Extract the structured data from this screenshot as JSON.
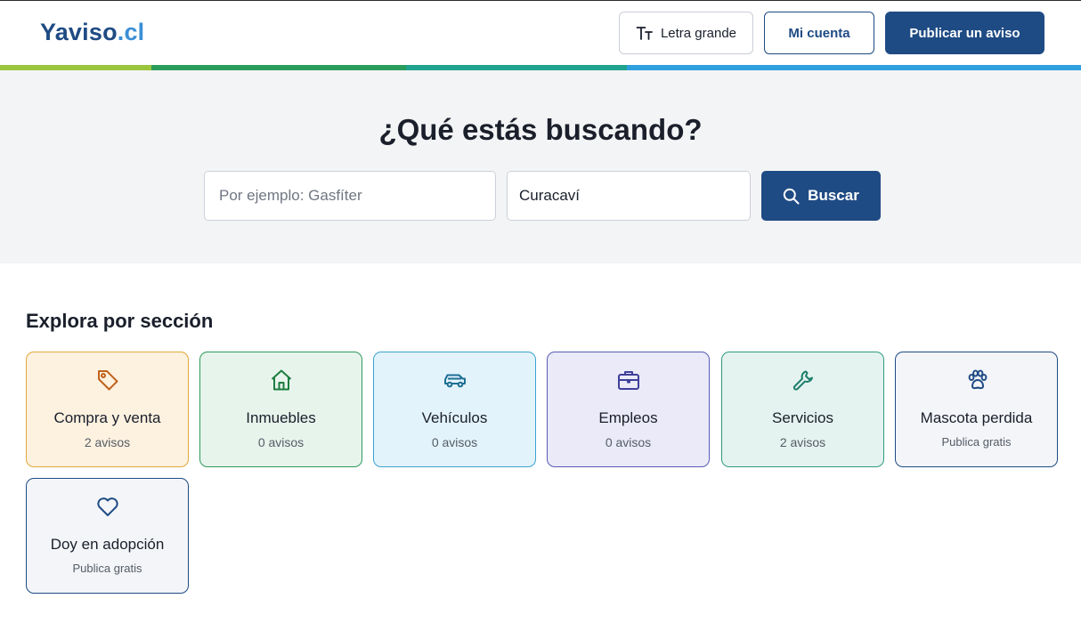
{
  "header": {
    "logo_main": "Yaviso",
    "logo_ext": ".cl",
    "large_text_label": "Letra grande",
    "account_label": "Mi cuenta",
    "publish_label": "Publicar un aviso"
  },
  "hero": {
    "title": "¿Qué estás buscando?",
    "search_placeholder": "Por ejemplo: Gasfíter",
    "location_value": "Curacaví",
    "search_button": "Buscar"
  },
  "sections": {
    "title": "Explora por sección",
    "items": [
      {
        "name": "Compra y venta",
        "sub": "2 avisos",
        "icon": "tag-icon",
        "color": "#c0621b"
      },
      {
        "name": "Inmuebles",
        "sub": "0 avisos",
        "icon": "house-icon",
        "color": "#1e7d40"
      },
      {
        "name": "Vehículos",
        "sub": "0 avisos",
        "icon": "car-icon",
        "color": "#1d6f95"
      },
      {
        "name": "Empleos",
        "sub": "0 avisos",
        "icon": "briefcase-icon",
        "color": "#3f3f9a"
      },
      {
        "name": "Servicios",
        "sub": "2 avisos",
        "icon": "wrench-icon",
        "color": "#1e7e6b"
      },
      {
        "name": "Mascota perdida",
        "sub": "Publica gratis",
        "icon": "paw-icon",
        "color": "#1f4b84"
      },
      {
        "name": "Doy en adopción",
        "sub": "Publica gratis",
        "icon": "heart-icon",
        "color": "#1f4b84"
      }
    ]
  },
  "colors": {
    "primary": "#1f4b84",
    "logo_accent": "#3a8fd6",
    "hero_bg": "#f3f4f5"
  }
}
